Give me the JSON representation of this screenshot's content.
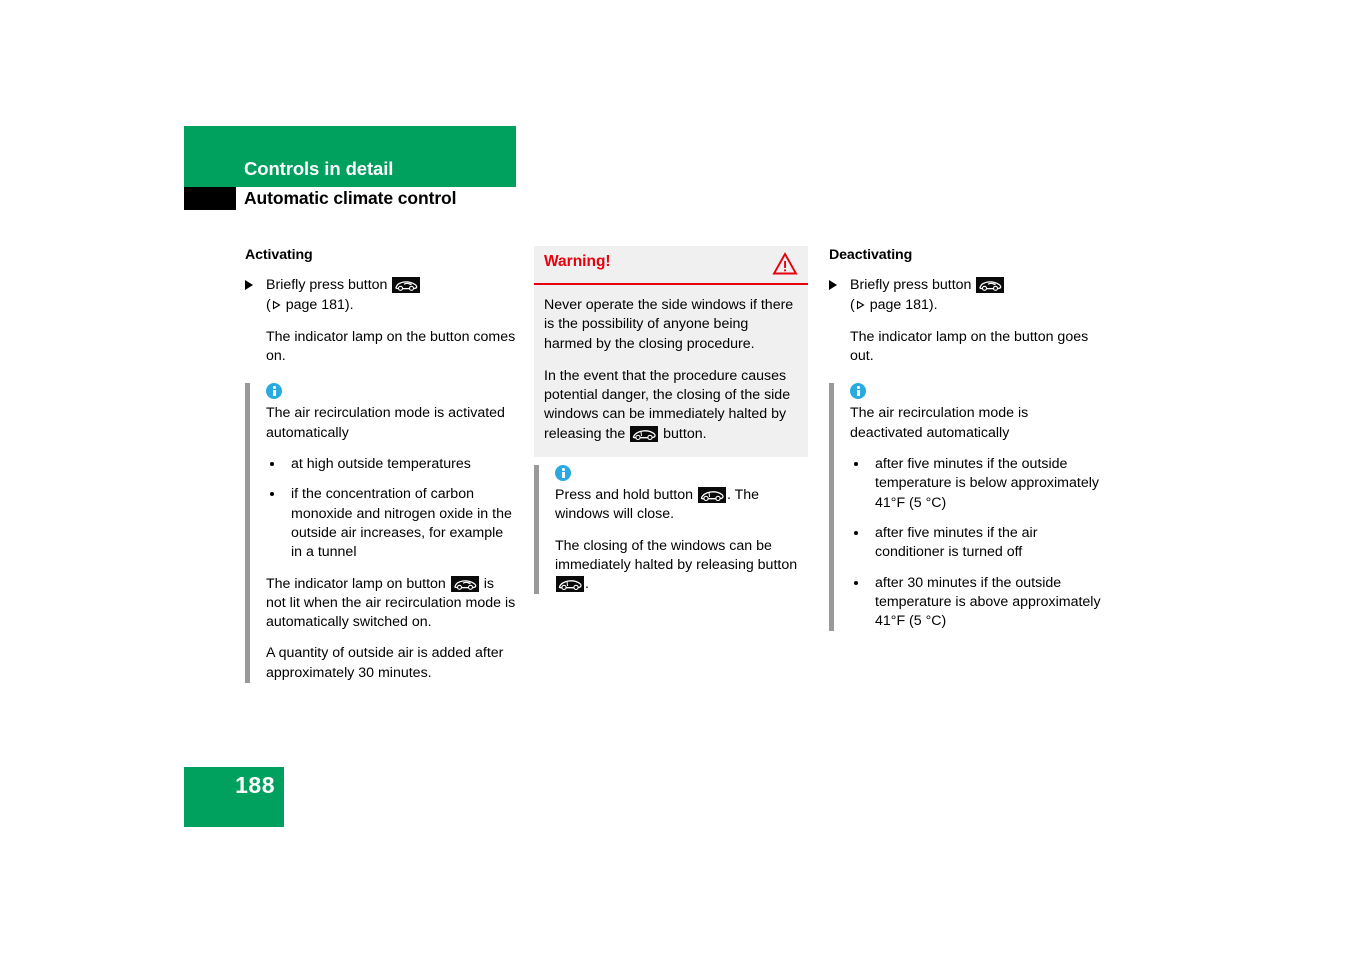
{
  "header": {
    "band_title": "Controls in detail",
    "subtitle": "Automatic climate control"
  },
  "footer": {
    "page_number": "188"
  },
  "icons": {
    "recirculation_button": "air-recirculation-button-icon",
    "window_button": "side-window-button-icon",
    "info": "info-icon",
    "warning_triangle": "warning-triangle-icon",
    "step_marker": "filled-right-triangle-icon",
    "page_ref_marker": "hollow-right-triangle-icon"
  },
  "colors": {
    "brand_green": "#00a05e",
    "warning_red": "#e8000d",
    "info_blue": "#29abe2",
    "rule_gray": "#999999",
    "warning_bg": "#f0f0f0"
  },
  "left_column": {
    "heading": "Activating",
    "step_text_before_icon": "Briefly press button",
    "step_page_ref": "page 181).",
    "step_page_ref_open": "(",
    "result_text": "The indicator lamp on the button comes on.",
    "info": {
      "intro": "The air recirculation mode is activated automatically",
      "bullets": [
        "at high outside temperatures",
        "if the concentration of carbon monoxide and nitrogen oxide in the outside air increases, for example in a tunnel"
      ],
      "note_part1": "The indicator lamp on button",
      "note_part2": "is not lit when the air recirculation mode is automatically switched on.",
      "closing": "A quantity of outside air is added after approximately 30 minutes."
    }
  },
  "middle_column": {
    "warning": {
      "title": "Warning!",
      "paragraph1": "Never operate the side windows if there is the possibility of anyone being harmed by the closing procedure.",
      "paragraph2_part1": "In the event that the procedure causes potential danger, the closing of the side windows can be immediately halted by releasing the",
      "paragraph2_part2": "button."
    },
    "info": {
      "paragraph1_part1": "Press and hold button",
      "paragraph1_part2": ". The windows will close.",
      "paragraph2_part1": "The closing of the windows can be immediately halted by releasing button",
      "paragraph2_part2": "."
    }
  },
  "right_column": {
    "heading": "Deactivating",
    "step_text_before_icon": "Briefly press button",
    "step_page_ref": "page 181).",
    "step_page_ref_open": "(",
    "result_text": "The indicator lamp on the button goes out.",
    "info": {
      "intro": "The air recirculation mode is deactivated automatically",
      "bullets": [
        "after five minutes if the outside temperature is below approximately 41°F (5 °C)",
        "after five minutes if the air conditioner is turned off",
        "after 30 minutes if the outside temperature is above approximately 41°F (5 °C)"
      ]
    }
  }
}
